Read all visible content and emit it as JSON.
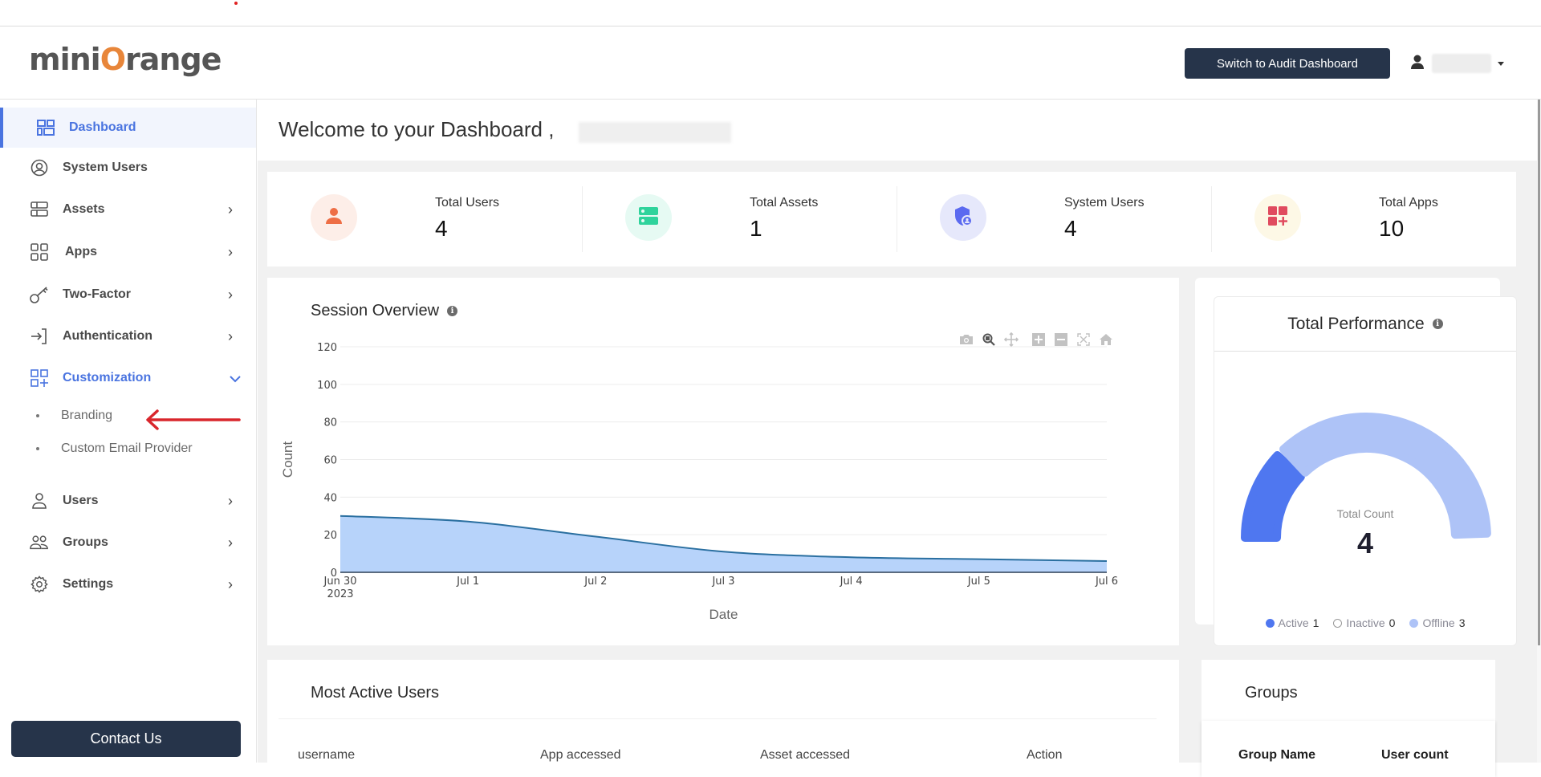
{
  "header": {
    "logo_text_pre": "mini",
    "logo_text_o": "O",
    "logo_text_post": "range",
    "switch_button": "Switch to Audit Dashboard",
    "user_icon": "user-icon",
    "user_menu_caret": "caret-down-icon"
  },
  "sidebar": {
    "items": [
      {
        "label": "Dashboard",
        "icon": "dashboard-icon",
        "active": true,
        "chevron": false
      },
      {
        "label": "System Users",
        "icon": "user-circle-icon",
        "chevron": false
      },
      {
        "label": "Assets",
        "icon": "server-icon",
        "chevron": true
      },
      {
        "label": "Apps",
        "icon": "apps-grid-icon",
        "chevron": true
      },
      {
        "label": "Two-Factor",
        "icon": "key-icon",
        "chevron": true
      },
      {
        "label": "Authentication",
        "icon": "login-icon",
        "chevron": true
      },
      {
        "label": "Customization",
        "icon": "grid-plus-icon",
        "chevron": true,
        "expanded": true
      },
      {
        "label": "Users",
        "icon": "user-icon",
        "chevron": true
      },
      {
        "label": "Groups",
        "icon": "group-icon",
        "chevron": true
      },
      {
        "label": "Settings",
        "icon": "gear-icon",
        "chevron": true
      }
    ],
    "sub_items": [
      {
        "label": "Branding"
      },
      {
        "label": "Custom Email Provider"
      }
    ],
    "contact_button": "Contact Us"
  },
  "main": {
    "welcome": "Welcome to your Dashboard ,",
    "stats": [
      {
        "label": "Total Users",
        "value": "4",
        "icon": "user-icon",
        "color": "#ee6e45",
        "bg": "#fdeee8"
      },
      {
        "label": "Total Assets",
        "value": "1",
        "icon": "server-icon",
        "color": "#2fd39c",
        "bg": "#e6faf3"
      },
      {
        "label": "System Users",
        "value": "4",
        "icon": "shield-user-icon",
        "color": "#5b6af0",
        "bg": "#e6e8fb"
      },
      {
        "label": "Total Apps",
        "value": "10",
        "icon": "apps-plus-icon",
        "color": "#e04b5f",
        "bg": "#fdf8e6"
      }
    ],
    "session_overview": {
      "title": "Session Overview",
      "modebar": [
        "camera-icon",
        "zoom-icon",
        "pan-icon",
        "zoom-in-icon",
        "zoom-out-icon",
        "autoscale-icon",
        "home-icon"
      ]
    },
    "total_performance": {
      "title": "Total Performance",
      "center_label": "Total Count",
      "center_value": "4",
      "legend": [
        {
          "label": "Active",
          "value": "1",
          "color": "#4f77f0"
        },
        {
          "label": "Inactive",
          "value": "0",
          "color": "#ffffff"
        },
        {
          "label": "Offline",
          "value": "3",
          "color": "#aec3f7"
        }
      ]
    },
    "most_active_users": {
      "title": "Most Active Users",
      "columns": [
        "username",
        "App accessed",
        "Asset accessed",
        "Action"
      ]
    },
    "groups": {
      "title": "Groups",
      "columns": [
        "Group Name",
        "User count"
      ]
    }
  },
  "chart_data": {
    "type": "area",
    "title": "Session Overview",
    "xlabel": "Date",
    "ylabel": "Count",
    "x": [
      "2023-06-30",
      "2023-07-01",
      "2023-07-02",
      "2023-07-03",
      "2023-07-04",
      "2023-07-05",
      "2023-07-06"
    ],
    "x_tick_labels": [
      "Jun 30\n2023",
      "Jul 1",
      "Jul 2",
      "Jul 3",
      "Jul 4",
      "Jul 5",
      "Jul 6"
    ],
    "series": [
      {
        "name": "Count",
        "values": [
          30,
          27,
          19,
          11,
          8,
          7,
          6
        ]
      }
    ],
    "ylim": [
      0,
      120
    ],
    "y_ticks": [
      0,
      20,
      40,
      60,
      80,
      100,
      120
    ],
    "grid": true,
    "line_color": "#2a6fa0",
    "fill_color": "#b7d3fa"
  }
}
